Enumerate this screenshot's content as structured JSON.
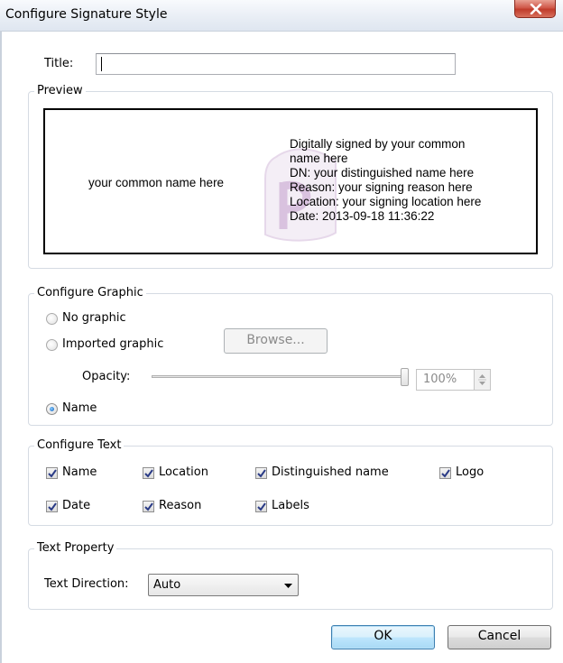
{
  "window": {
    "title": "Configure Signature Style"
  },
  "title_field": {
    "label": "Title:",
    "value": ""
  },
  "preview": {
    "label": "Preview",
    "name_text": "your common name here",
    "details": [
      "Digitally signed by your common",
      "name here",
      "DN: your distinguished name here",
      "Reason: your signing reason here",
      "Location: your signing location here",
      "Date: 2013-09-18 11:36:22"
    ]
  },
  "graphic": {
    "label": "Configure Graphic",
    "no_graphic": "No graphic",
    "imported_graphic": "Imported graphic",
    "browse": "Browse...",
    "opacity_label": "Opacity:",
    "opacity_value": "100%",
    "opacity_level": 1.0,
    "name": "Name",
    "selected": "name"
  },
  "text": {
    "label": "Configure Text",
    "items": [
      {
        "label": "Name",
        "checked": true
      },
      {
        "label": "Location",
        "checked": true
      },
      {
        "label": "Distinguished name",
        "checked": true
      },
      {
        "label": "Logo",
        "checked": true
      },
      {
        "label": "Date",
        "checked": true
      },
      {
        "label": "Reason",
        "checked": true
      },
      {
        "label": "Labels",
        "checked": true
      }
    ]
  },
  "text_property": {
    "label": "Text Property",
    "direction_label": "Text Direction:",
    "direction_value": "Auto"
  },
  "buttons": {
    "ok": "OK",
    "cancel": "Cancel"
  }
}
